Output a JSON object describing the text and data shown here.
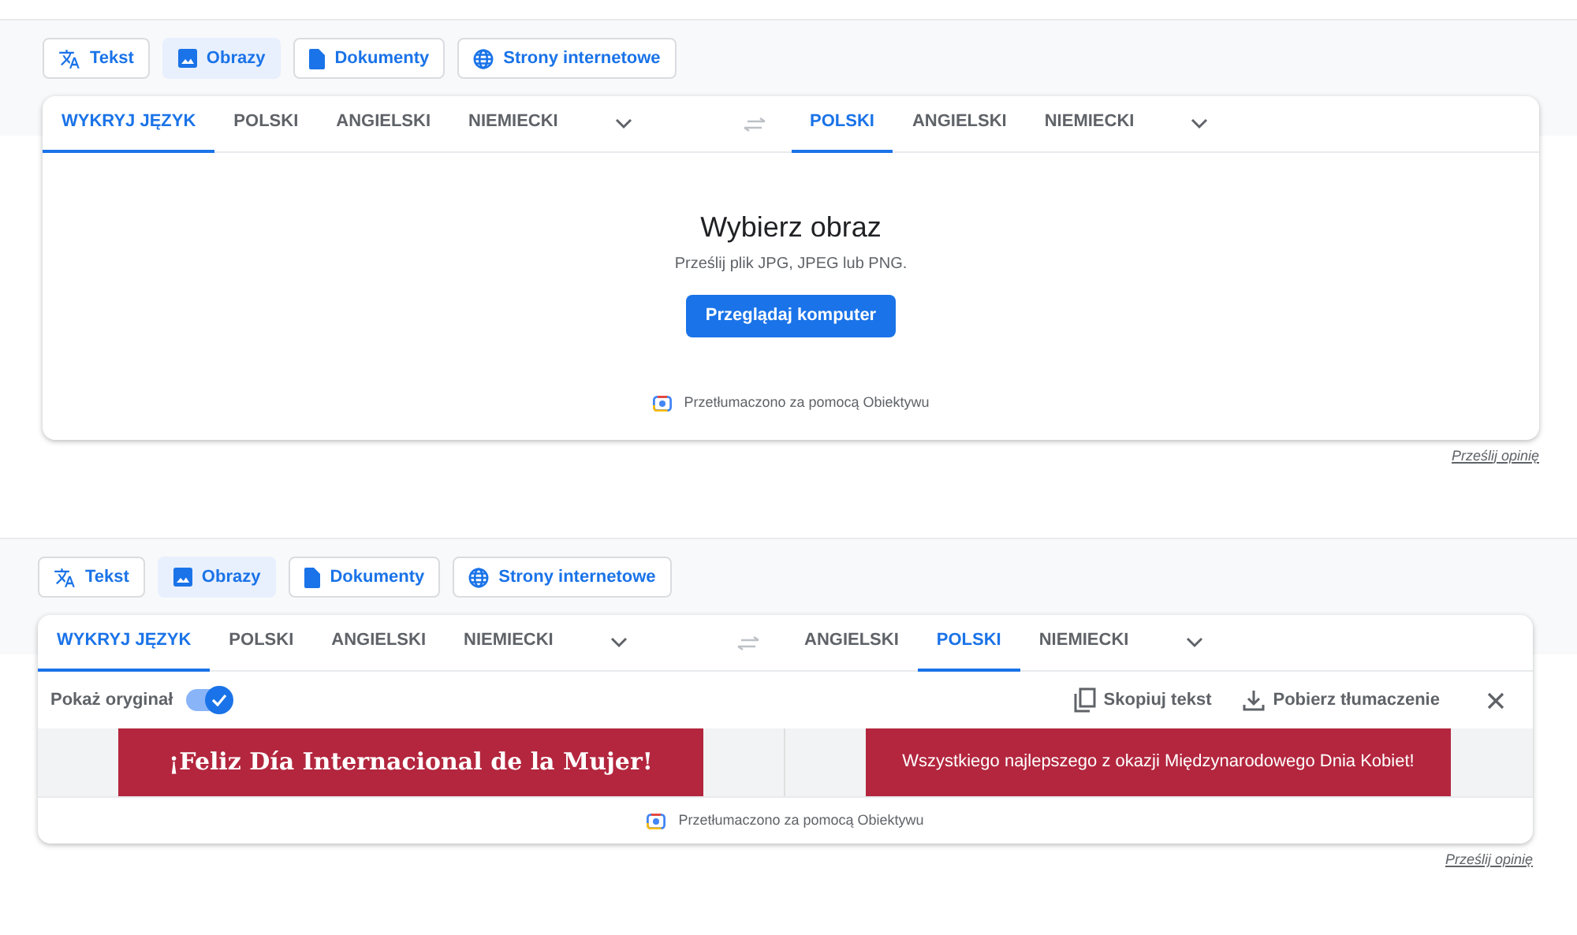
{
  "panels": [
    {
      "kind": "upload",
      "mode_tabs": [
        {
          "label": "Tekst",
          "kind": "translate",
          "selected": false
        },
        {
          "label": "Obrazy",
          "kind": "image",
          "selected": true
        },
        {
          "label": "Dokumenty",
          "kind": "document",
          "selected": false
        },
        {
          "label": "Strony internetowe",
          "kind": "globe",
          "selected": false
        }
      ],
      "source_langs": [
        {
          "label": "WYKRYJ JĘZYK",
          "selected": true
        },
        {
          "label": "POLSKI",
          "selected": false
        },
        {
          "label": "ANGIELSKI",
          "selected": false
        },
        {
          "label": "NIEMIECKI",
          "selected": false
        }
      ],
      "target_langs": [
        {
          "label": "POLSKI",
          "selected": true
        },
        {
          "label": "ANGIELSKI",
          "selected": false
        },
        {
          "label": "NIEMIECKI",
          "selected": false
        }
      ],
      "upload": {
        "title": "Wybierz obraz",
        "hint": "Prześlij plik JPG, JPEG lub PNG.",
        "button": "Przeglądaj komputer"
      },
      "credit": "Przetłumaczono za pomocą Obiektywu",
      "feedback": "Prześlij opinię"
    },
    {
      "kind": "result",
      "mode_tabs": [
        {
          "label": "Tekst",
          "kind": "translate",
          "selected": false
        },
        {
          "label": "Obrazy",
          "kind": "image",
          "selected": true
        },
        {
          "label": "Dokumenty",
          "kind": "document",
          "selected": false
        },
        {
          "label": "Strony internetowe",
          "kind": "globe",
          "selected": false
        }
      ],
      "source_langs": [
        {
          "label": "WYKRYJ JĘZYK",
          "selected": true
        },
        {
          "label": "POLSKI",
          "selected": false
        },
        {
          "label": "ANGIELSKI",
          "selected": false
        },
        {
          "label": "NIEMIECKI",
          "selected": false
        }
      ],
      "target_langs": [
        {
          "label": "ANGIELSKI",
          "selected": false
        },
        {
          "label": "POLSKI",
          "selected": true
        },
        {
          "label": "NIEMIECKI",
          "selected": false
        }
      ],
      "result": {
        "toggle_label": "Pokaż oryginał",
        "toggle_on": true,
        "actions": [
          {
            "label": "Skopiuj tekst",
            "kind": "copy"
          },
          {
            "label": "Pobierz tłumaczenie",
            "kind": "download"
          }
        ],
        "original_text": "¡Feliz Día Internacional de la Mujer!",
        "translated_text": "Wszystkiego najlepszego z okazji Międzynarodowego Dnia Kobiet!"
      },
      "credit": "Przetłumaczono za pomocą Obiektywu",
      "feedback": "Prześlij opinię"
    }
  ]
}
